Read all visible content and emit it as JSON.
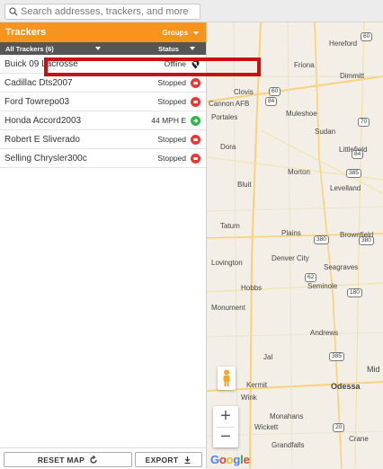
{
  "search": {
    "placeholder": "Search addresses, trackers, and more"
  },
  "panel": {
    "title": "Trackers",
    "groups_label": "Groups",
    "filter_label": "All Trackers (6)",
    "status_label": "Status"
  },
  "trackers": [
    {
      "name": "Buick 09 Lacrosse",
      "status": "Offline",
      "icon": "offline-icon"
    },
    {
      "name": "Cadillac Dts2007",
      "status": "Stopped",
      "icon": "stopped-icon"
    },
    {
      "name": "Ford Towrepo03",
      "status": "Stopped",
      "icon": "stopped-icon"
    },
    {
      "name": "Honda Accord2003",
      "status": "44 MPH E",
      "icon": "moving-icon"
    },
    {
      "name": "Robert E Sliverado",
      "status": "Stopped",
      "icon": "stopped-icon"
    },
    {
      "name": "Selling Chrysler300c",
      "status": "Stopped",
      "icon": "stopped-icon"
    }
  ],
  "footer": {
    "reset_label": "RESET MAP",
    "export_label": "EXPORT"
  },
  "map": {
    "places": [
      "Hereford",
      "Friona",
      "Dimmitt",
      "Clovis",
      "Cannon AFB",
      "Portales",
      "Muleshoe",
      "Sudan",
      "Dora",
      "Littlefield",
      "Morton",
      "Levelland",
      "Bluit",
      "Tatum",
      "Plains",
      "Brownfield",
      "Lovington",
      "Denver City",
      "Seagraves",
      "Seminole",
      "Hobbs",
      "Monument",
      "Andrews",
      "Jal",
      "Mid",
      "Kermit",
      "Odessa",
      "Wink",
      "Monahans",
      "Wickett",
      "Crane",
      "Grandfalls"
    ],
    "routes": [
      "60",
      "60",
      "84",
      "70",
      "385",
      "84",
      "380",
      "380",
      "62",
      "180",
      "385",
      "20"
    ],
    "brand": "Google"
  },
  "colors": {
    "accent": "#f6941d",
    "stopped": "#e53935",
    "moving": "#2eb84b",
    "highlight": "#c91010"
  }
}
